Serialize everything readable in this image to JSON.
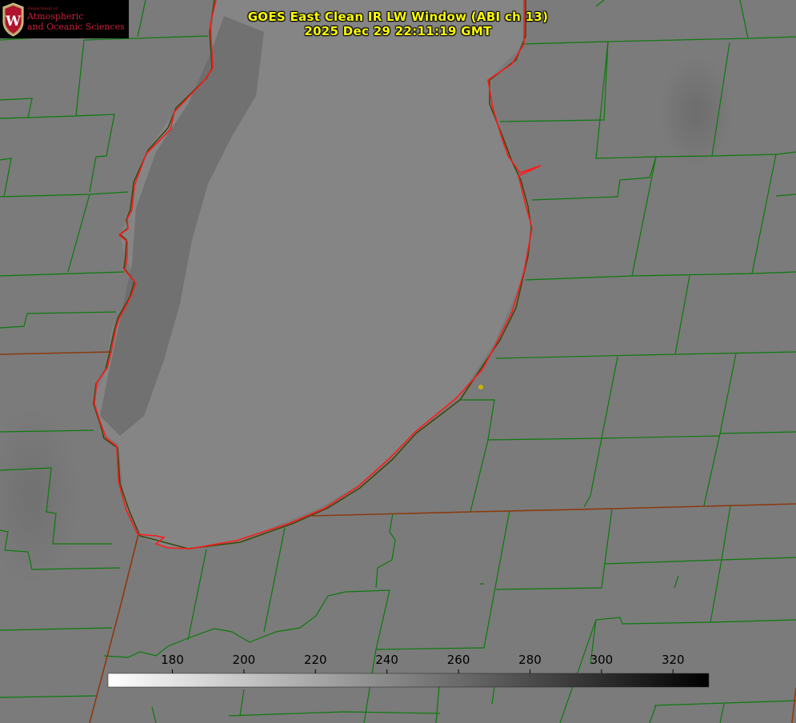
{
  "logo": {
    "department": "Department of",
    "line1": "Atmospheric",
    "line2": "and Oceanic Sciences",
    "seal_letter": "W"
  },
  "title": {
    "line1": "GOES East Clean IR LW Window (ABI ch 13)",
    "line2": "2025 Dec 29 22:11:19 GMT"
  },
  "colorbar": {
    "ticks": [
      "180",
      "200",
      "220",
      "240",
      "260",
      "280",
      "300",
      "320"
    ],
    "tick_values": [
      180,
      200,
      220,
      240,
      260,
      280,
      300,
      320
    ],
    "range": [
      162,
      330
    ],
    "low_color": "#ffffff",
    "high_color": "#000000"
  },
  "colors": {
    "background": "#7b7b7b",
    "lake": "#858585",
    "county_lines": "#0b7a0b",
    "state_lines": "#8b3a0e",
    "shoreline": "#ff1a1a",
    "title": "#ffff00",
    "marker": "#c8b400"
  }
}
